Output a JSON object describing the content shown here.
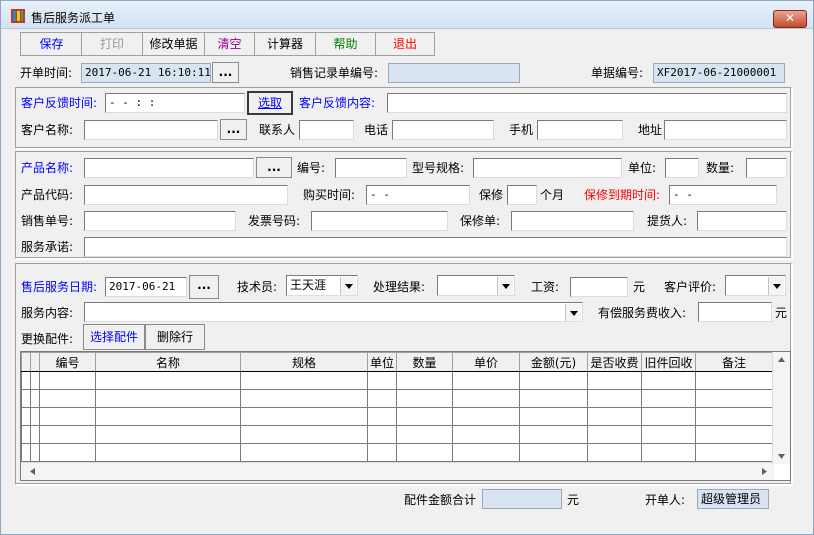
{
  "window": {
    "title": "售后服务派工单",
    "close_label": "✕"
  },
  "toolbar": {
    "save": "保存",
    "print": "打印",
    "edit": "修改单据",
    "clear": "清空",
    "calc": "计算器",
    "help": "帮助",
    "exit": "退出"
  },
  "header": {
    "open_time_label": "开单时间:",
    "open_time_value": "2017-06-21 16:10:11",
    "sales_record_label": "销售记录单编号:",
    "sales_record_value": "",
    "doc_no_label": "单据编号:",
    "doc_no_value": "XF2017-06-21000001"
  },
  "customer": {
    "feedback_time_label": "客户反馈时间:",
    "feedback_time_value": "  -  -      :  :",
    "pick_label": "选取",
    "feedback_content_label": "客户反馈内容:",
    "name_label": "客户名称:",
    "contact_label": "联系人",
    "phone_label": "电话",
    "mobile_label": "手机",
    "address_label": "地址"
  },
  "product": {
    "name_label": "产品名称:",
    "number_label": "编号:",
    "model_label": "型号规格:",
    "unit_label": "单位:",
    "qty_label": "数量:",
    "code_label": "产品代码:",
    "purchase_time_label": "购买时间:",
    "purchase_time_value": "  -  -",
    "warranty_label": "保修",
    "months_label": "个月",
    "warranty_end_label": "保修到期时间:",
    "warranty_end_value": "  -  -",
    "sales_no_label": "销售单号:",
    "invoice_label": "发票号码:",
    "warranty_doc_label": "保修单:",
    "picker_label": "提货人:",
    "promise_label": "服务承诺:"
  },
  "service": {
    "date_label": "售后服务日期:",
    "date_value": "2017-06-21",
    "tech_label": "技术员:",
    "tech_value": "王天涯",
    "result_label": "处理结果:",
    "wage_label": "工资:",
    "yuan": "元",
    "rating_label": "客户评价:",
    "content_label": "服务内容:",
    "paid_income_label": "有偿服务费收入:",
    "yuan2": "元"
  },
  "parts": {
    "label": "更换配件:",
    "select_btn": "选择配件",
    "delete_btn": "删除行",
    "columns": [
      "编号",
      "名称",
      "规格",
      "单位",
      "数量",
      "单价",
      "金额(元)",
      "是否收费",
      "旧件回收",
      "备注"
    ]
  },
  "footer": {
    "total_label": "配件金额合计",
    "total_value": "",
    "yuan": "元",
    "creator_label": "开单人:",
    "creator_value": "超级管理员"
  }
}
